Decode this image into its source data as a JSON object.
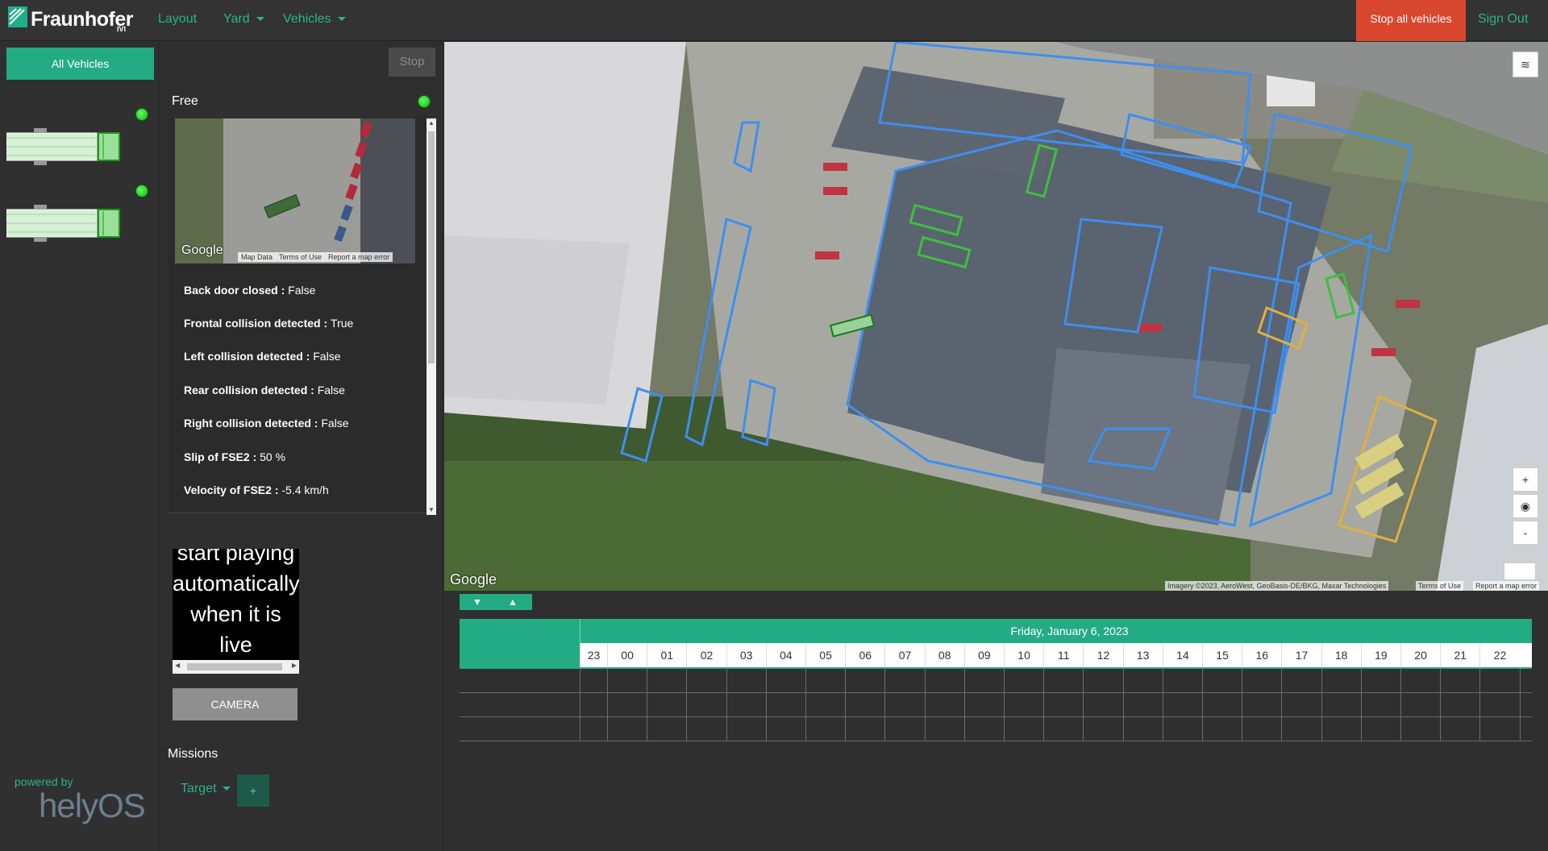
{
  "nav": {
    "brand": "Fraunhofer",
    "brand_sub": "IVI",
    "layout": "Layout",
    "yard": "Yard",
    "vehicles": "Vehicles",
    "stop_all": "Stop all vehicles",
    "sign_out": "Sign Out"
  },
  "sidebar": {
    "all_vehicles": "All Vehicles",
    "powered_by": "powered by",
    "helyos": "helyOS"
  },
  "details": {
    "stop": "Stop",
    "status": "Free",
    "minimap_google": "Google",
    "minimap_attrib": [
      "Map Data",
      "Terms of Use",
      "Report a map error"
    ],
    "properties": [
      {
        "label": "Back door closed : ",
        "value": "False"
      },
      {
        "label": "Frontal collision detected : ",
        "value": "True"
      },
      {
        "label": "Left collision detected : ",
        "value": "False"
      },
      {
        "label": "Rear collision detected : ",
        "value": "False"
      },
      {
        "label": "Right collision detected : ",
        "value": "False"
      },
      {
        "label": "Slip of FSE2 : ",
        "value": "50 %"
      },
      {
        "label": "Velocity of FSE2 : ",
        "value": "-5.4 km/h"
      }
    ],
    "video_lines": [
      "start playing",
      "automatically",
      "when it is",
      "live"
    ],
    "camera": "CAMERA",
    "missions": "Missions",
    "target": "Target",
    "add": "+"
  },
  "map": {
    "google": "Google",
    "attribution": "Imagery ©2023, AeroWest, GeoBasis-DE/BKG, Maxar Technologies",
    "terms": "Terms of Use",
    "report": "Report a map error",
    "zoom_in": "+",
    "locate": "◉",
    "zoom_out": "-"
  },
  "timeline": {
    "date": "Friday, January 6, 2023",
    "hours": [
      "23",
      "00",
      "01",
      "02",
      "03",
      "04",
      "05",
      "06",
      "07",
      "08",
      "09",
      "10",
      "11",
      "12",
      "13",
      "14",
      "15",
      "16",
      "17",
      "18",
      "19",
      "20",
      "21",
      "22"
    ]
  }
}
